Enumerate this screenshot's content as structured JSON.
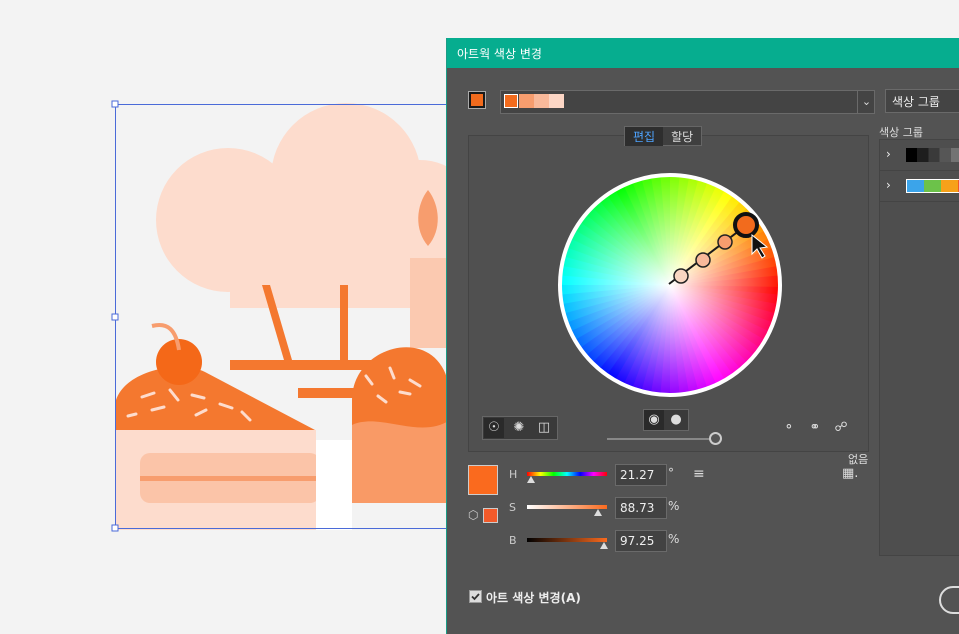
{
  "dialog": {
    "title": "아트웍 색상 변경",
    "color_group_dropdown": "색상 그룹",
    "tabs": [
      {
        "label": "편집",
        "active": true
      },
      {
        "label": "할당",
        "active": false
      }
    ],
    "color_groups_label": "색상 그룹",
    "none_label": "없음",
    "harmony_colors": [
      "#f26b1d",
      "#f79d6e",
      "#f9b99a",
      "#fcd6c5"
    ],
    "color_group_swatches": [
      [
        "#000000",
        "#1e1e1e",
        "#3a3a3a",
        "#565656",
        "#737373",
        "#8f8f8f"
      ],
      [
        "#3ba4ea",
        "#6cc24a",
        "#f7a11a",
        "#f1592a"
      ]
    ],
    "sliders": {
      "h": {
        "label": "H",
        "value": "21.27",
        "unit": "°",
        "level": 0.06
      },
      "s": {
        "label": "S",
        "value": "88.73",
        "unit": "%",
        "level": 0.8873
      },
      "b": {
        "label": "B",
        "value": "97.25",
        "unit": "%",
        "level": 0.9725
      }
    },
    "recolor_art_label": "아트 색상 변경(A)",
    "recolor_art_checked": true,
    "base_color": "#fa6a1e"
  }
}
